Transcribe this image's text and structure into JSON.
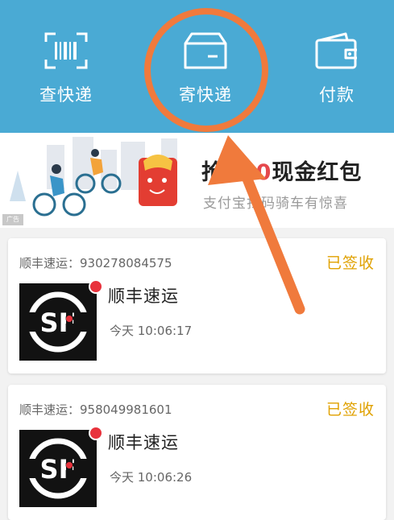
{
  "top_actions": {
    "query": {
      "label": "查快递",
      "icon": "barcode-scan-icon"
    },
    "send": {
      "label": "寄快递",
      "icon": "parcel-box-icon"
    },
    "pay": {
      "label": "付款",
      "icon": "wallet-icon"
    }
  },
  "banner": {
    "title_prefix": "抢",
    "title_amount": "520",
    "title_suffix": "现金红包",
    "subtitle": "支付宝扫码骑车有惊喜",
    "ad_label": "广告"
  },
  "packages": [
    {
      "tracking": "顺丰速运：930278084575",
      "status": "已签收",
      "company": "顺丰速运",
      "time": "今天 10:06:17",
      "logo": "sf-express-logo"
    },
    {
      "tracking": "顺丰速运：958049981601",
      "status": "已签收",
      "company": "顺丰速运",
      "time": "今天 10:06:26",
      "logo": "sf-express-logo"
    }
  ],
  "colors": {
    "header": "#4aaad4",
    "status": "#e0a100",
    "highlight": "#f07a3c",
    "unread_dot": "#e8323c"
  }
}
